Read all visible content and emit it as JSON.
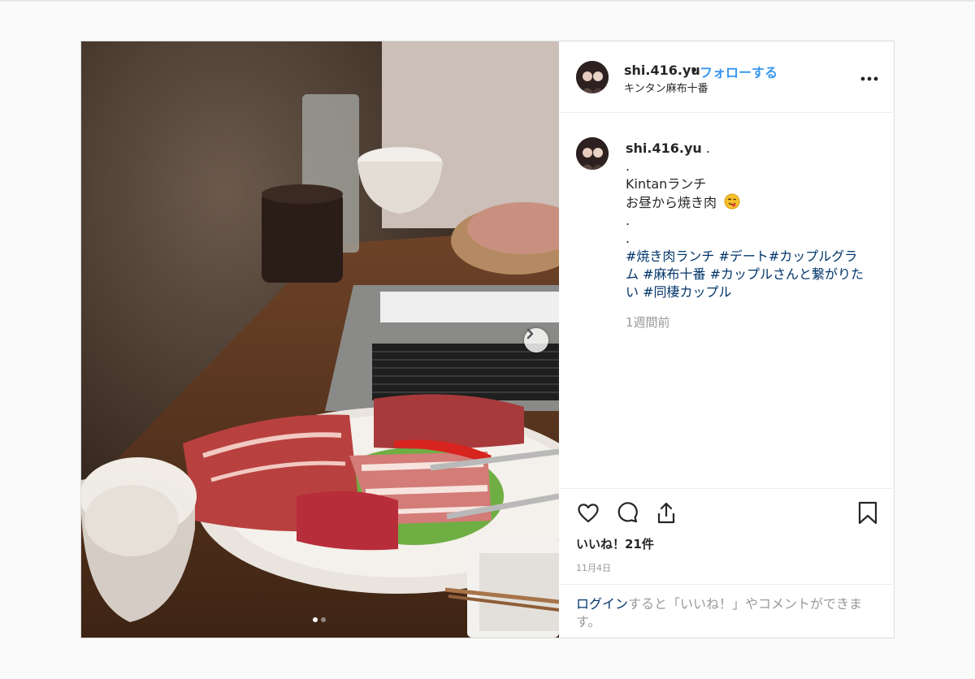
{
  "post": {
    "username": "shi.416.yu",
    "separator": "•",
    "follow_label": "フォローする",
    "location": "キンタン麻布十番",
    "more_label": "•••"
  },
  "caption": {
    "username": "shi.416.yu",
    "lines": [
      ".",
      ".",
      "Kintanランチ",
      "お昼から焼き肉",
      ".",
      "."
    ],
    "hashtags": "#焼き肉ランチ #デート#カップルグラム #麻布十番 #カップルさんと繋がりたい #同棲カップル",
    "emoji_icon": "face-savoring-food-icon",
    "time_ago": "1週間前"
  },
  "actions": {
    "icons": [
      "heart-icon",
      "comment-icon",
      "share-icon",
      "bookmark-icon"
    ],
    "likes": "いいね！21件",
    "date": "11月4日"
  },
  "login_prompt": {
    "link": "ログイン",
    "text": "すると「いいね！」やコメントができます。"
  },
  "carousel": {
    "current": 1,
    "total": 2,
    "next_icon": "chevron-right-icon"
  },
  "colors": {
    "accent": "#3897f0",
    "hashtag": "#003569",
    "muted": "#999999"
  }
}
